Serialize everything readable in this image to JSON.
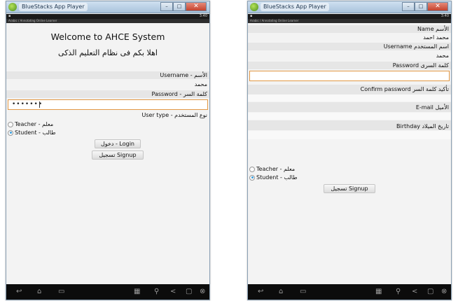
{
  "left": {
    "window_title": "BlueStacks App Player",
    "status_time": "3:40",
    "app_header": "Arabic / Annotating Online Learner",
    "welcome": "Welcome to AHCE System",
    "arabic_welcome": "اهلا بكم فى نظام التعليم الذكى",
    "username_label": "الأسم - Username",
    "username_value": "محمد",
    "password_label": "كلمة السر - Password",
    "password_value": "•••••••",
    "usertype_label": "نوع المستخدم - User type",
    "radio_teacher": "Teacher - معلم",
    "radio_student": "Student - طالب",
    "selected_role": "Student",
    "login_button": "دخول - Login",
    "signup_button": "تسجيل Signup"
  },
  "right": {
    "window_title": "BlueStacks App Player",
    "status_time": "3:40",
    "app_header": "Arabic / Annotating Online Learner",
    "name_label": "الأسم Name",
    "name_value": "محمد احمد",
    "username_label": "اسم المستخدم Username",
    "username_value": "محمد",
    "password_label": "كلمة السرى Password",
    "confirm_label": "تأكيد كلمة السر Confirm password",
    "email_label": "الأميل E-mail",
    "birthday_label": "تاريخ الميلاد Birthday",
    "radio_teacher": "Teacher - معلم",
    "radio_student": "Student - طالب",
    "selected_role": "Student",
    "signup_button": "تسجيل Signup"
  },
  "icons": [
    "bluestacks-logo-icon",
    "minimize-icon",
    "maximize-icon",
    "close-icon",
    "back-icon",
    "home-icon",
    "recent-apps-icon",
    "keyboard-icon",
    "location-icon",
    "share-icon",
    "screen-icon",
    "settings-icon"
  ]
}
